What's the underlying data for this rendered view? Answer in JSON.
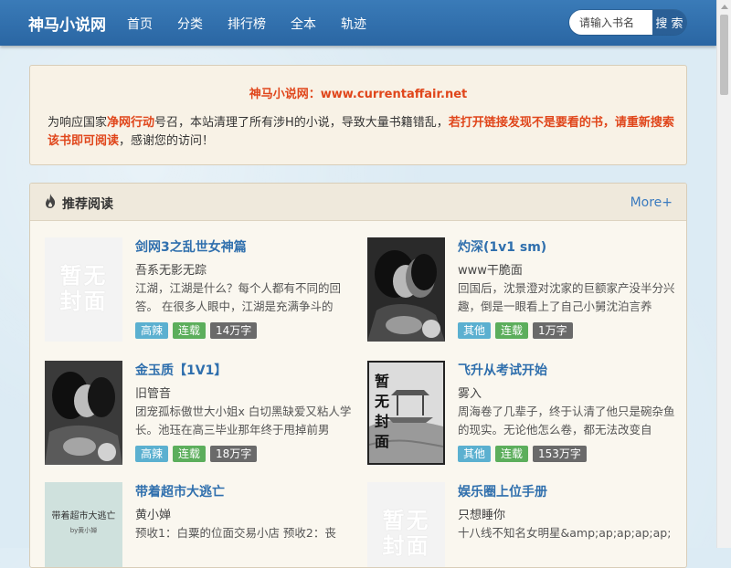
{
  "site": {
    "logo": "神马小说网"
  },
  "nav": [
    "首页",
    "分类",
    "排行榜",
    "全本",
    "轨迹"
  ],
  "search": {
    "placeholder": "请输入书名",
    "button": "搜 索"
  },
  "notice": {
    "title": "神马小说网：www.currentaffair.net",
    "p1": "为响应国家",
    "p1_red": "净网行动",
    "p2": "号召，本站清理了所有涉H的小说，导致大量书籍错乱，",
    "p2_red": "若打开链接发现不是要看的书，请重新搜索该书即可阅读",
    "p3": "，感谢您的访问！"
  },
  "recommend": {
    "title": "推荐阅读",
    "more": "More+",
    "books": [
      {
        "title": "剑网3之乱世女神篇",
        "author": "吾系无影无踪",
        "desc": "江湖，江湖是什么？每个人都有不同的回答。 在很多人眼中，江湖是充满争斗的",
        "tags": [
          "高辣",
          "连载",
          "14万字"
        ],
        "cover": "placeholder"
      },
      {
        "title": "灼深(1v1 sm)",
        "author": "www干脆面",
        "desc": "回国后，沈景澄对沈家的巨额家产没半分兴趣，倒是一眼看上了自己小舅沈泊言养",
        "tags": [
          "其他",
          "连载",
          "1万字"
        ],
        "cover": "photo"
      },
      {
        "title": "金玉质【1V1】",
        "author": "旧管音",
        "desc": "团宠孤标傲世大小姐x 白切黑缺爱又粘人学长。池珏在高三毕业那年终于甩掉前男",
        "tags": [
          "高辣",
          "连载",
          "18万字"
        ],
        "cover": "photo"
      },
      {
        "title": "飞升从考试开始",
        "author": "雾入",
        "desc": "周海卷了几辈子，终于认清了他只是碗杂鱼的现实。无论他怎么卷，都无法改变自",
        "tags": [
          "其他",
          "连载",
          "153万字"
        ],
        "cover": "pavilion"
      },
      {
        "title": "带着超市大逃亡",
        "author": "黄小婵",
        "desc": "预收1：白粟的位面交易小店 预收2：丧",
        "tags": [],
        "cover": "text",
        "cover_title": "带着超市大逃亡",
        "cover_author": "by黄小婵"
      },
      {
        "title": "娱乐圈上位手册",
        "author": "只想睡你",
        "desc": "十八线不知名女明星&amp;ap;ap;ap;ap;",
        "tags": [],
        "cover": "placeholder"
      }
    ]
  },
  "placeholder_text": "暂无封面",
  "colors": {
    "nav": "#2f6fad",
    "accent_red": "#e0461b",
    "link_blue": "#2f6fad"
  }
}
